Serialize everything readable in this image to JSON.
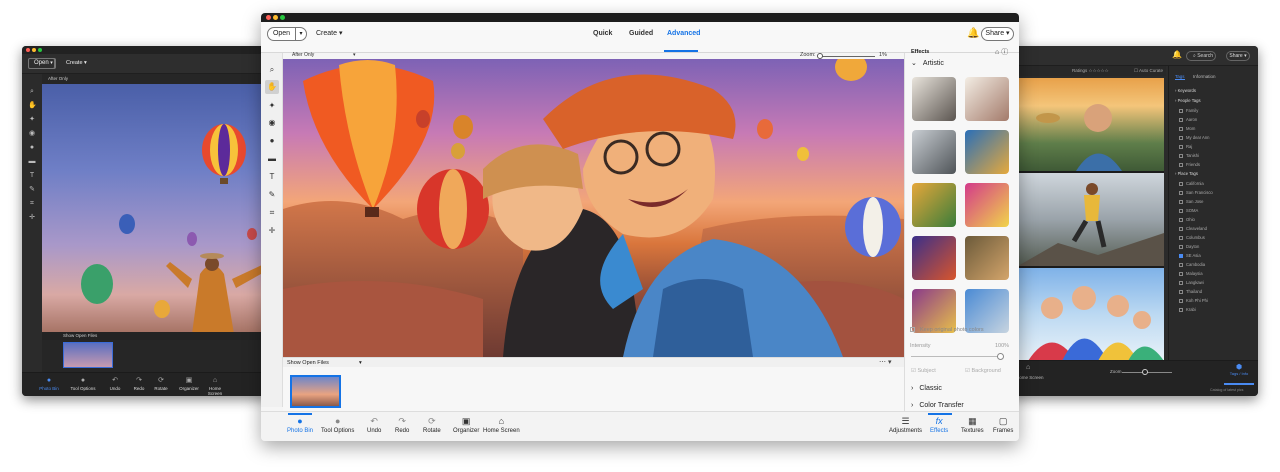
{
  "left_window": {
    "menu": {
      "open_label": "Open",
      "create_label": "Create"
    },
    "view_select": "After Only",
    "photo_bin_label": "Show Open Files",
    "bottom_bar": [
      {
        "icon": "photo-bin-icon",
        "label": "Photo Bin"
      },
      {
        "icon": "tool-options-icon",
        "label": "Tool Options"
      },
      {
        "icon": "undo-icon",
        "label": "Undo"
      },
      {
        "icon": "redo-icon",
        "label": "Redo"
      },
      {
        "icon": "rotate-icon",
        "label": "Rotate"
      },
      {
        "icon": "organizer-icon",
        "label": "Organizer"
      },
      {
        "icon": "home-screen-icon",
        "label": "Home Screen"
      }
    ]
  },
  "right_window": {
    "search_label": "Search",
    "share_label": "Share",
    "ratings_label": "Ratings",
    "auto_curate_label": "Auto Curate",
    "panel_tabs": {
      "tags": "Tags",
      "information": "Information"
    },
    "tag_tree": [
      {
        "label": "Keywords",
        "type": "header"
      },
      {
        "label": "People Tags",
        "type": "header"
      },
      {
        "label": "Family",
        "type": "item"
      },
      {
        "label": "Aaron",
        "type": "item"
      },
      {
        "label": "Mom",
        "type": "item"
      },
      {
        "label": "My dear Ann",
        "type": "item"
      },
      {
        "label": "Raj",
        "type": "item"
      },
      {
        "label": "Tanishi",
        "type": "item"
      },
      {
        "label": "Friends",
        "type": "item"
      },
      {
        "label": "Place Tags",
        "type": "header"
      },
      {
        "label": "California",
        "type": "item"
      },
      {
        "label": "San Francisco",
        "type": "item"
      },
      {
        "label": "San Jose",
        "type": "item"
      },
      {
        "label": "SOMA",
        "type": "item"
      },
      {
        "label": "Ohio",
        "type": "item"
      },
      {
        "label": "Cleaveland",
        "type": "item"
      },
      {
        "label": "Columbus",
        "type": "item"
      },
      {
        "label": "Dayton",
        "type": "item"
      },
      {
        "label": "SE Asia",
        "type": "item",
        "checked": true
      },
      {
        "label": "Cambodia",
        "type": "item"
      },
      {
        "label": "Malaysia",
        "type": "item"
      },
      {
        "label": "Langkawi",
        "type": "item"
      },
      {
        "label": "Thailand",
        "type": "item"
      },
      {
        "label": "Koh Phi Phi",
        "type": "item"
      },
      {
        "label": "Krabi",
        "type": "item"
      }
    ],
    "bottom": {
      "home_screen_label": "Home Screen",
      "zoom_label": "Zoom",
      "tags_label": "Tags / Info",
      "catalog_label": "Catalog of latest pics"
    }
  },
  "center_window": {
    "menu": {
      "open_label": "Open",
      "create_label": "Create",
      "share_label": "Share"
    },
    "mode_tabs": [
      {
        "label": "Quick",
        "active": false
      },
      {
        "label": "Guided",
        "active": false
      },
      {
        "label": "Advanced",
        "active": true
      }
    ],
    "view_select": "After Only",
    "zoom": {
      "label": "Zoom:",
      "value": "1%"
    },
    "photo_bin_label": "Show Open Files",
    "effects": {
      "title": "Effects",
      "section": "Artistic",
      "keep_colors_label": "Keep original photo colors",
      "intensity_label": "Intensity",
      "intensity_value": "100%",
      "intensity_level": 1.0,
      "subject_label": "Subject",
      "background_label": "Background",
      "categories": [
        "Classic",
        "Color Transfer"
      ],
      "thumb_colors": [
        [
          "#e9e4dc",
          "#5b5550"
        ],
        [
          "#f3ede4",
          "#a37a6a"
        ],
        [
          "#c8cdd2",
          "#4f5458"
        ],
        [
          "#2a6fb8",
          "#e6a93c"
        ],
        [
          "#e6a73a",
          "#3a7d3a"
        ],
        [
          "#d33a8a",
          "#f1d54a"
        ],
        [
          "#3a2f8a",
          "#d8552c"
        ],
        [
          "#6b5a3a",
          "#d4a56b"
        ],
        [
          "#8a3a8a",
          "#e8c04a"
        ],
        [
          "#4a8ad4",
          "#c7d4e0"
        ]
      ]
    },
    "bottom_bar": [
      {
        "icon": "photo-bin-icon",
        "label": "Photo Bin",
        "active": true
      },
      {
        "icon": "tool-options-icon",
        "label": "Tool Options"
      },
      {
        "icon": "undo-icon",
        "label": "Undo"
      },
      {
        "icon": "redo-icon",
        "label": "Redo"
      },
      {
        "icon": "rotate-icon",
        "label": "Rotate"
      },
      {
        "icon": "organizer-icon",
        "label": "Organizer"
      },
      {
        "icon": "home-screen-icon",
        "label": "Home Screen"
      },
      {
        "icon": "adjustments-icon",
        "label": "Adjustments"
      },
      {
        "icon": "effects-icon",
        "label": "Effects",
        "active": true
      },
      {
        "icon": "textures-icon",
        "label": "Textures"
      },
      {
        "icon": "frames-icon",
        "label": "Frames"
      }
    ]
  },
  "colors": {
    "accent": "#1473e6",
    "dark_bg": "#2b2b2b",
    "light_bg": "#f5f5f5"
  }
}
